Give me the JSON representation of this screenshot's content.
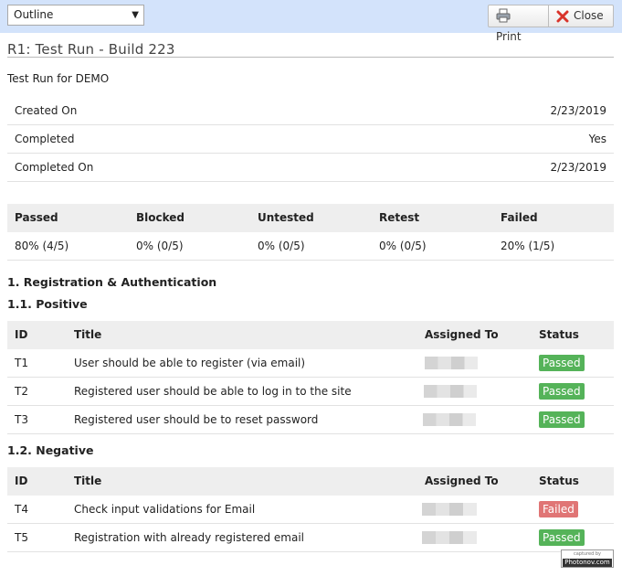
{
  "toolbar": {
    "view_select": "Outline",
    "print_label": "Print",
    "close_label": "Close",
    "print_icon": "printer-icon",
    "close_icon": "x-icon"
  },
  "title": "R1: Test Run - Build 223",
  "description": "Test Run for DEMO",
  "info": [
    {
      "label": "Created On",
      "value": "2/23/2019"
    },
    {
      "label": "Completed",
      "value": "Yes"
    },
    {
      "label": "Completed On",
      "value": "2/23/2019"
    }
  ],
  "summary": {
    "headers": [
      "Passed",
      "Blocked",
      "Untested",
      "Retest",
      "Failed"
    ],
    "values": [
      "80% (4/5)",
      "0% (0/5)",
      "0% (0/5)",
      "0% (0/5)",
      "20% (1/5)"
    ]
  },
  "section": "1. Registration & Authentication",
  "columns": {
    "id": "ID",
    "title": "Title",
    "assigned": "Assigned To",
    "status": "Status"
  },
  "groups": [
    {
      "name": "1.1. Positive",
      "tests": [
        {
          "id": "T1",
          "title": "User should be able to register (via email)",
          "status": "Passed"
        },
        {
          "id": "T2",
          "title": "Registered user should be able to log in to the site",
          "status": "Passed"
        },
        {
          "id": "T3",
          "title": "Registered user should be to reset password",
          "status": "Passed"
        }
      ]
    },
    {
      "name": "1.2. Negative",
      "tests": [
        {
          "id": "T4",
          "title": "Check input validations for Email",
          "status": "Failed"
        },
        {
          "id": "T5",
          "title": "Registration with already registered email",
          "status": "Passed"
        }
      ]
    }
  ],
  "watermark": {
    "top": "captured by",
    "bottom": "Photonov.com"
  },
  "colors": {
    "toolbar_bg": "#d3e3fb",
    "passed": "#55b359",
    "failed": "#e07575",
    "close_icon": "#d9342b"
  }
}
